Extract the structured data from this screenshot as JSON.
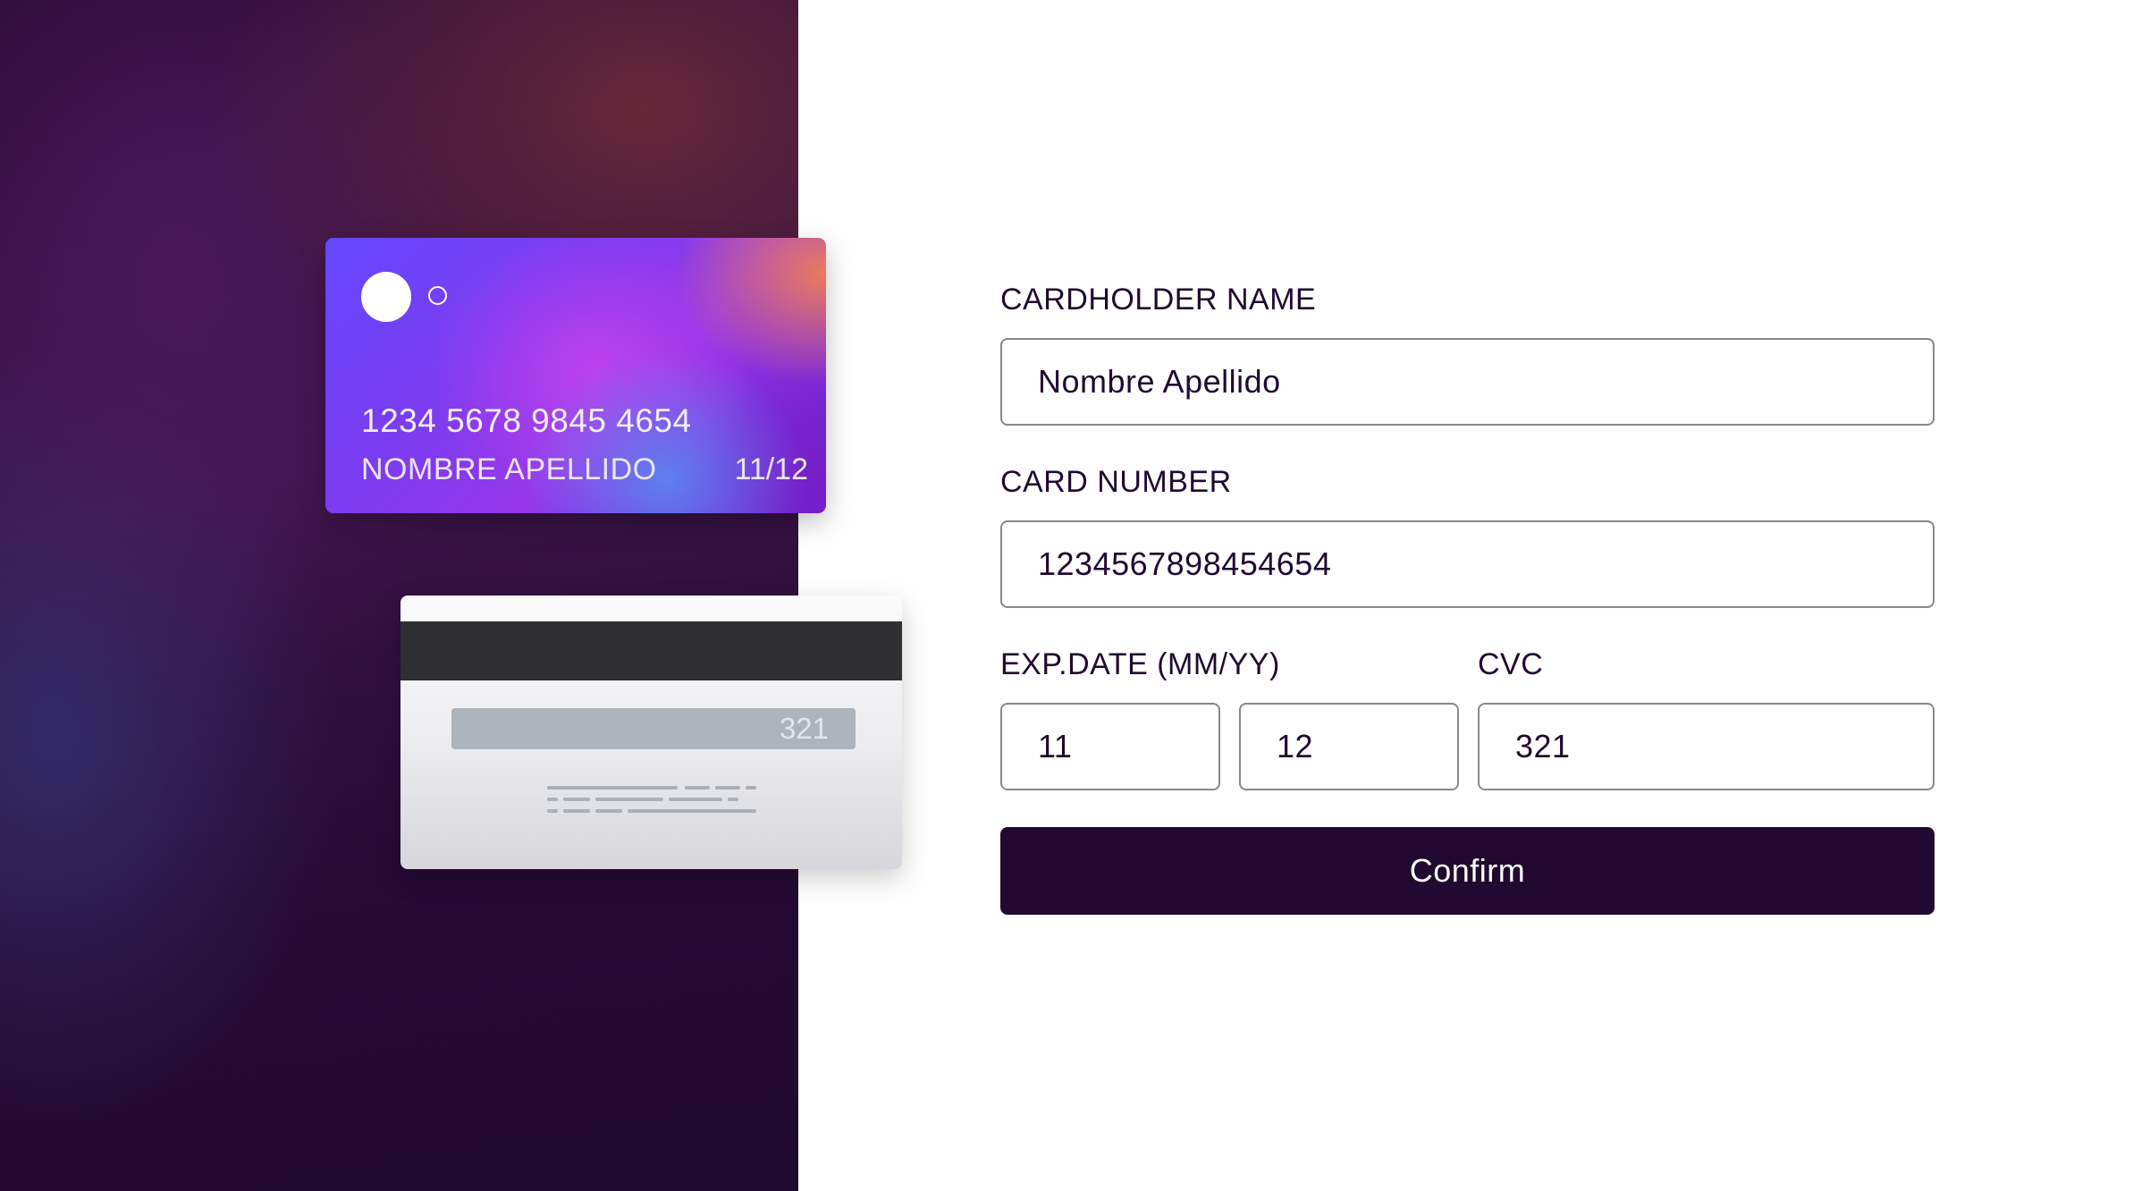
{
  "card_front": {
    "number": "1234 5678 9845 4654",
    "name": "NOMBRE APELLIDO",
    "exp": "11/12"
  },
  "card_back": {
    "cvc": "321"
  },
  "form": {
    "cardholder_label": "CARDHOLDER NAME",
    "cardholder_value": "Nombre Apellido",
    "number_label": "CARD NUMBER",
    "number_value": "1234567898454654",
    "exp_label": "EXP.DATE (MM/YY)",
    "exp_month_value": "11",
    "exp_year_value": "12",
    "cvc_label": "CVC",
    "cvc_value": "321",
    "confirm_label": "Confirm"
  },
  "colors": {
    "primary": "#21092f",
    "input_border": "#8a878c",
    "background": "#ffffff"
  }
}
